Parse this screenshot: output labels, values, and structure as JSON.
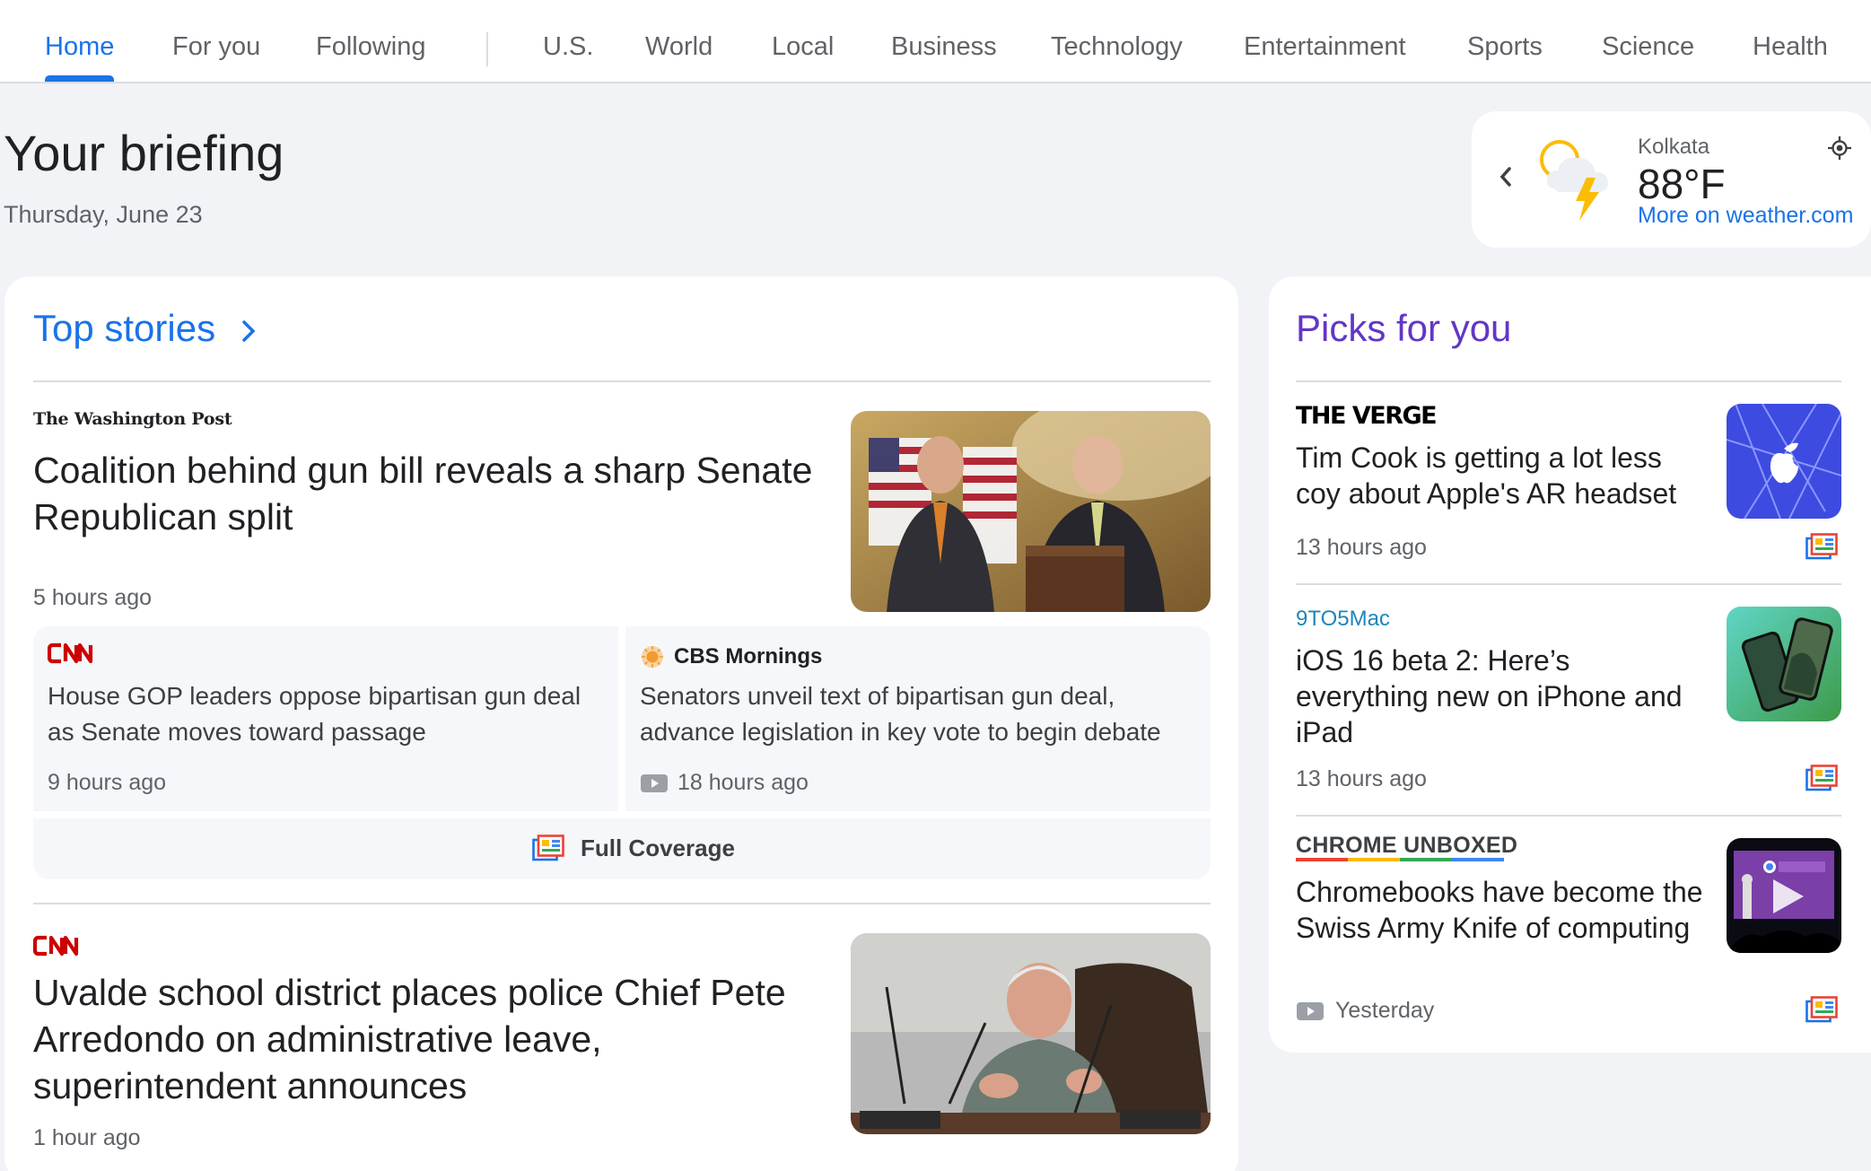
{
  "nav": {
    "tabs": [
      {
        "label": "Home",
        "active": true
      },
      {
        "label": "For you"
      },
      {
        "label": "Following"
      },
      {
        "label": "U.S."
      },
      {
        "label": "World"
      },
      {
        "label": "Local"
      },
      {
        "label": "Business"
      },
      {
        "label": "Technology"
      },
      {
        "label": "Entertainment"
      },
      {
        "label": "Sports"
      },
      {
        "label": "Science"
      },
      {
        "label": "Health"
      }
    ]
  },
  "briefing": {
    "title": "Your briefing",
    "date": "Thursday, June 23"
  },
  "weather": {
    "city": "Kolkata",
    "temperature": "88°F",
    "link": "More on weather.com",
    "icon": "partly-cloudy-thunder-icon"
  },
  "top_stories": {
    "heading": "Top stories",
    "story1": {
      "source": "The Washington Post",
      "headline": "Coalition behind gun bill reveals a sharp Senate Republican split",
      "time": "5 hours ago",
      "related": [
        {
          "source": "CNN",
          "headline": "House GOP leaders oppose bipartisan gun deal as Senate moves toward passage",
          "time": "9 hours ago"
        },
        {
          "source": "CBS Mornings",
          "headline": "Senators unveil text of bipartisan gun deal, advance legislation in key vote to begin debate",
          "time": "18 hours ago"
        }
      ],
      "full_coverage": "Full Coverage"
    },
    "story2": {
      "source": "CNN",
      "headline": "Uvalde school district places police Chief Pete Arredondo on administrative leave, superintendent announces",
      "time": "1 hour ago"
    }
  },
  "picks": {
    "heading": "Picks for you",
    "items": [
      {
        "source": "THE VERGE",
        "headline": "Tim Cook is getting a lot less coy about Apple's AR headset",
        "time": "13 hours ago"
      },
      {
        "source": "9TO5Mac",
        "headline": "iOS 16 beta 2: Here’s everything new on iPhone and iPad",
        "time": "13 hours ago"
      },
      {
        "source": "CHROME UNBOXED",
        "headline": "Chromebooks have become the Swiss Army Knife of computing",
        "time": "Yesterday"
      }
    ]
  },
  "colors": {
    "accent": "#1a73e8",
    "picks_title": "#6236c6",
    "cnn_red": "#cc0000",
    "background": "#f1f3f7"
  }
}
